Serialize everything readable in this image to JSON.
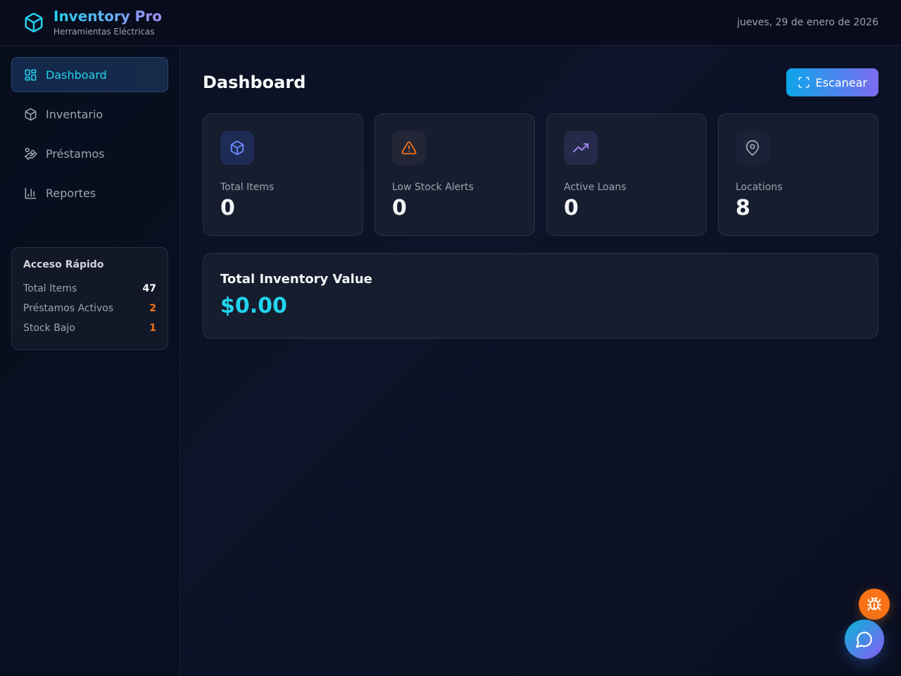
{
  "header": {
    "title": "Inventory Pro",
    "subtitle": "Herramientas Eléctricas",
    "date": "jueves, 29 de enero de 2026",
    "logo_icon": "box-icon"
  },
  "sidebar": {
    "items": [
      {
        "label": "Dashboard",
        "icon": "layout-grid-icon",
        "active": true
      },
      {
        "label": "Inventario",
        "icon": "box-icon",
        "active": false
      },
      {
        "label": "Préstamos",
        "icon": "hand-coins-icon",
        "active": false
      },
      {
        "label": "Reportes",
        "icon": "bar-chart-icon",
        "active": false
      }
    ],
    "quick_access": {
      "title": "Acceso Rápido",
      "rows": [
        {
          "label": "Total Items",
          "value": "47",
          "color": "#ffffff"
        },
        {
          "label": "Préstamos Activos",
          "value": "2",
          "color": "#f97316"
        },
        {
          "label": "Stock Bajo",
          "value": "1",
          "color": "#f97316"
        }
      ]
    }
  },
  "main": {
    "title": "Dashboard",
    "scan_button": {
      "label": "Escanear",
      "icon": "scan-icon"
    },
    "cards": [
      {
        "label": "Total Items",
        "value": "0",
        "icon": "box-icon",
        "accent": "#6b8cff"
      },
      {
        "label": "Low Stock Alerts",
        "value": "0",
        "icon": "alert-triangle-icon",
        "accent": "#f97316"
      },
      {
        "label": "Active Loans",
        "value": "0",
        "icon": "trending-up-icon",
        "accent": "#a78bfa"
      },
      {
        "label": "Locations",
        "value": "8",
        "icon": "map-pin-icon",
        "accent": "#9ca3af"
      }
    ],
    "value_card": {
      "title": "Total Inventory Value",
      "amount": "$0.00"
    }
  },
  "fabs": {
    "bug": {
      "icon": "bug-icon",
      "color": "#f97316"
    },
    "chat": {
      "icon": "chat-bubble-icon"
    }
  },
  "colors": {
    "accent_cyan": "#22d3ee",
    "accent_violet": "#a78bfa",
    "warning": "#f97316",
    "background": "#0b1022"
  }
}
